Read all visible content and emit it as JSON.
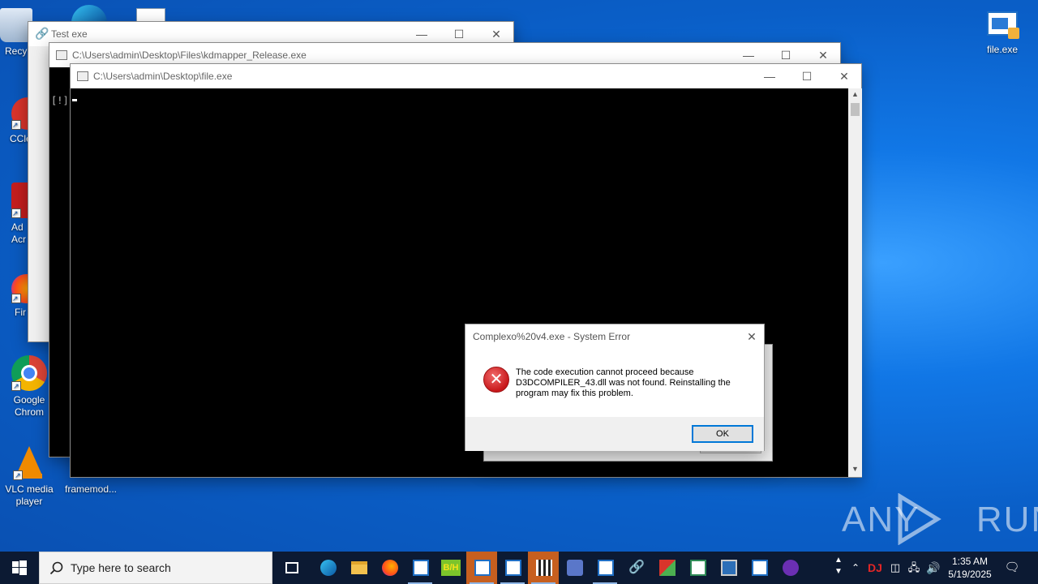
{
  "desktop": {
    "icons": [
      {
        "label": "Recy",
        "icon": "recycle-bin-icon"
      },
      {
        "label": "CCle",
        "icon": "ccleaner-icon"
      },
      {
        "label": "Ad Acr",
        "icon": "acrobat-icon"
      },
      {
        "label": "Fir",
        "icon": "firefox-icon"
      },
      {
        "label": "Google Chrom",
        "icon": "chrome-icon"
      },
      {
        "label": "VLC media player",
        "icon": "vlc-icon"
      },
      {
        "label": "framemod...",
        "icon": "file-icon"
      },
      {
        "label": "file.exe",
        "icon": "exe-icon"
      }
    ],
    "watermark": "ANY RUN"
  },
  "windows": {
    "test_exe": {
      "title": "Test exe"
    },
    "kdmapper": {
      "title": "C:\\Users\\admin\\Desktop\\Files\\kdmapper_Release.exe",
      "console_text": "[!]"
    },
    "file_exe": {
      "title": "C:\\Users\\admin\\Desktop\\file.exe"
    }
  },
  "dialog": {
    "title": "Complexo%20v4.exe - System Error",
    "message": "The code execution cannot proceed because D3DCOMPILER_43.dll was not found. Reinstalling the program may fix this problem.",
    "ok_label": "OK",
    "close_glyph": "✕"
  },
  "controls": {
    "min": "—",
    "max": "☐",
    "close": "✕"
  },
  "taskbar": {
    "search_placeholder": "Type here to search",
    "bh_label": "B/H",
    "time": "1:35 AM",
    "date": "5/19/2025",
    "tray_brand": "DJ"
  },
  "colors": {
    "accent": "#0078d7",
    "error": "#d9292b",
    "taskbar": "#0c1a33"
  }
}
